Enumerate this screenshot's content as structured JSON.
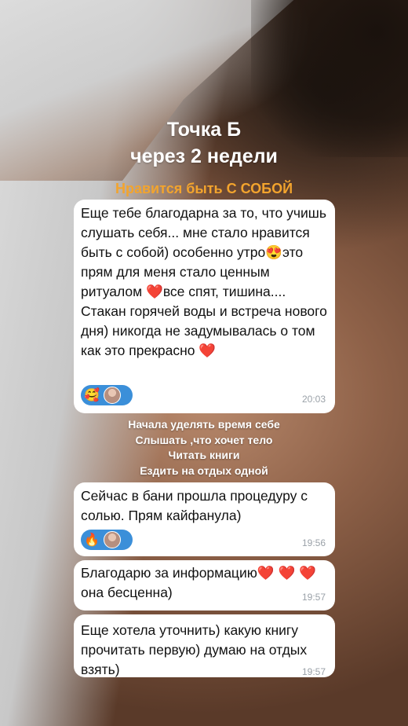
{
  "header": {
    "title_line1": "Точка Б",
    "title_line2": "через 2 недели",
    "subtitle": "Нравится быть С СОБОЙ"
  },
  "messages": [
    {
      "text": "Еще тебе благодарна за то, что учишь слушать себя... мне стало нравится быть с собой) особенно утро😍это прям для меня стало ценным ритуалом ❤️все спят, тишина.... Стакан горячей воды и встреча нового дня) никогда не задумывалась о том как это прекрасно ❤️",
      "reaction_emoji": "🥰",
      "time": "20:03"
    },
    {
      "text": "Сейчас в бани прошла процедуру с солью. Прям кайфанула)",
      "reaction_emoji": "🔥",
      "time": "19:56"
    },
    {
      "text": "Благодарю за информацию❤️ ❤️ ❤️она бесценна)",
      "time": "19:57"
    },
    {
      "text": "Еще хотела уточнить) какую книгу прочитать первую) думаю на отдых взять)",
      "time": "19:57"
    }
  ],
  "caption": {
    "lines": [
      "Начала  уделять время себе",
      "Слышать ,что хочет тело",
      "Читать книги",
      "Ездить на отдых одной"
    ]
  },
  "colors": {
    "reaction_bg": "#3b8fd9",
    "subtitle": "#f3a42d",
    "heart": "#e5262d"
  }
}
